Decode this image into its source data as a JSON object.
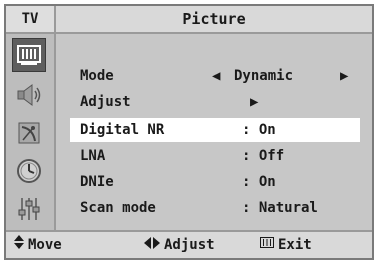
{
  "header": {
    "source": "TV",
    "title": "Picture"
  },
  "sidebar": {
    "icons": [
      "picture-icon",
      "sound-icon",
      "channel-icon",
      "timer-icon",
      "setup-icon"
    ],
    "selected": "picture-icon"
  },
  "menu": {
    "items": [
      {
        "label": "Mode",
        "value": "Dynamic"
      },
      {
        "label": "Adjust",
        "value": ""
      },
      {
        "label": "Digital NR",
        "value": ": On"
      },
      {
        "label": "LNA",
        "value": ": Off"
      },
      {
        "label": "DNIe",
        "value": ": On"
      },
      {
        "label": "Scan mode",
        "value": ": Natural"
      }
    ],
    "highlighted": "Digital NR"
  },
  "footer": {
    "move": "Move",
    "adjust": "Adjust",
    "exit": "Exit"
  }
}
